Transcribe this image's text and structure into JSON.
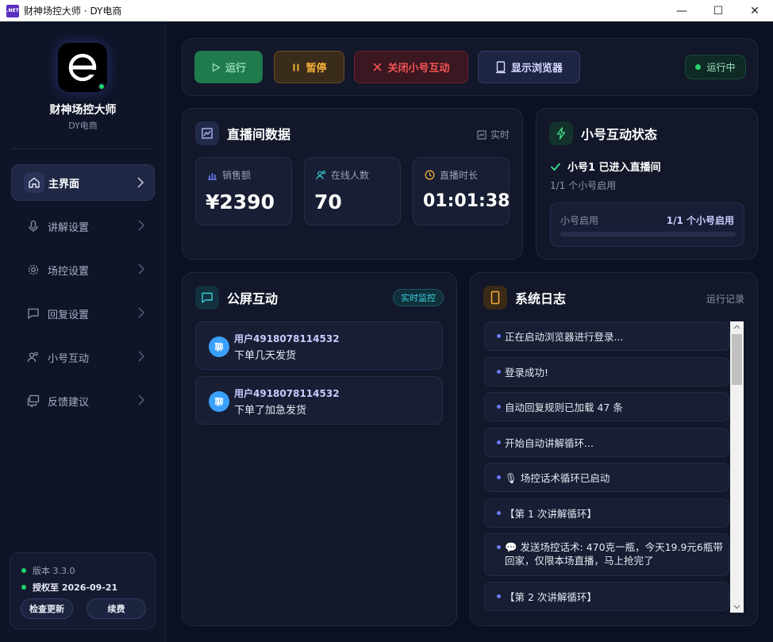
{
  "window": {
    "title": "财神场控大师 · DY电商",
    "app_icon_text": ".NET",
    "minimize": "—",
    "maximize": "☐",
    "close": "✕"
  },
  "sidebar": {
    "brand": "财神场控大师",
    "subtitle": "DY电商",
    "logo_icon": "e-logo-icon",
    "items": [
      {
        "label": "主界面",
        "icon": "home-icon",
        "active": true
      },
      {
        "label": "讲解设置",
        "icon": "microphone-icon",
        "active": false
      },
      {
        "label": "场控设置",
        "icon": "gear-icon",
        "active": false
      },
      {
        "label": "回复设置",
        "icon": "chat-icon",
        "active": false
      },
      {
        "label": "小号互动",
        "icon": "users-icon",
        "active": false
      },
      {
        "label": "反馈建议",
        "icon": "feedback-icon",
        "active": false
      }
    ],
    "version": "版本 3.3.0",
    "license": "授权至 2026-09-21",
    "check_update": "检查更新",
    "renew": "续费"
  },
  "toolbar": {
    "run": "运行",
    "pause": "暂停",
    "close_alt": "关闭小号互动",
    "show_browser": "显示浏览器",
    "status": "运行中"
  },
  "live": {
    "title": "直播间数据",
    "realtime": "实时",
    "sales_label": "销售额",
    "sales_value": "¥2390",
    "online_label": "在线人数",
    "online_value": "70",
    "duration_label": "直播时长",
    "duration_value": "01:01:38"
  },
  "alt_status": {
    "title": "小号互动状态",
    "line1": "小号1 已进入直播间",
    "line2": "1/1 个小号启用",
    "bar_label": "小号启用",
    "bar_value": "1/1 个小号启用",
    "progress": 1.0
  },
  "public": {
    "title": "公屏互动",
    "badge": "实时监控",
    "messages": [
      {
        "avatar": "聊",
        "user": "用户4918078114532",
        "text": "下单几天发货"
      },
      {
        "avatar": "聊",
        "user": "用户4918078114532",
        "text": "下单了加急发货"
      }
    ]
  },
  "log": {
    "title": "系统日志",
    "link": "运行记录",
    "entries": [
      "正在启动浏览器进行登录...",
      "登录成功!",
      "自动回复规则已加载 47 条",
      "开始自动讲解循环...",
      "🎙 场控话术循环已启动",
      "【第 1 次讲解循环】",
      "💬 发送场控话术: 470克一瓶，今天19.9元6瓶带回家，仅限本场直播，马上抢完了",
      "【第 2 次讲解循环】"
    ]
  },
  "colors": {
    "background": "#0c1121",
    "card": "#121729",
    "run_green": "#1f7a4d",
    "pause_amber": "#f3b13a",
    "close_red": "#f25353",
    "accent_blue": "#6b7cff",
    "online_green": "#22d36b"
  }
}
